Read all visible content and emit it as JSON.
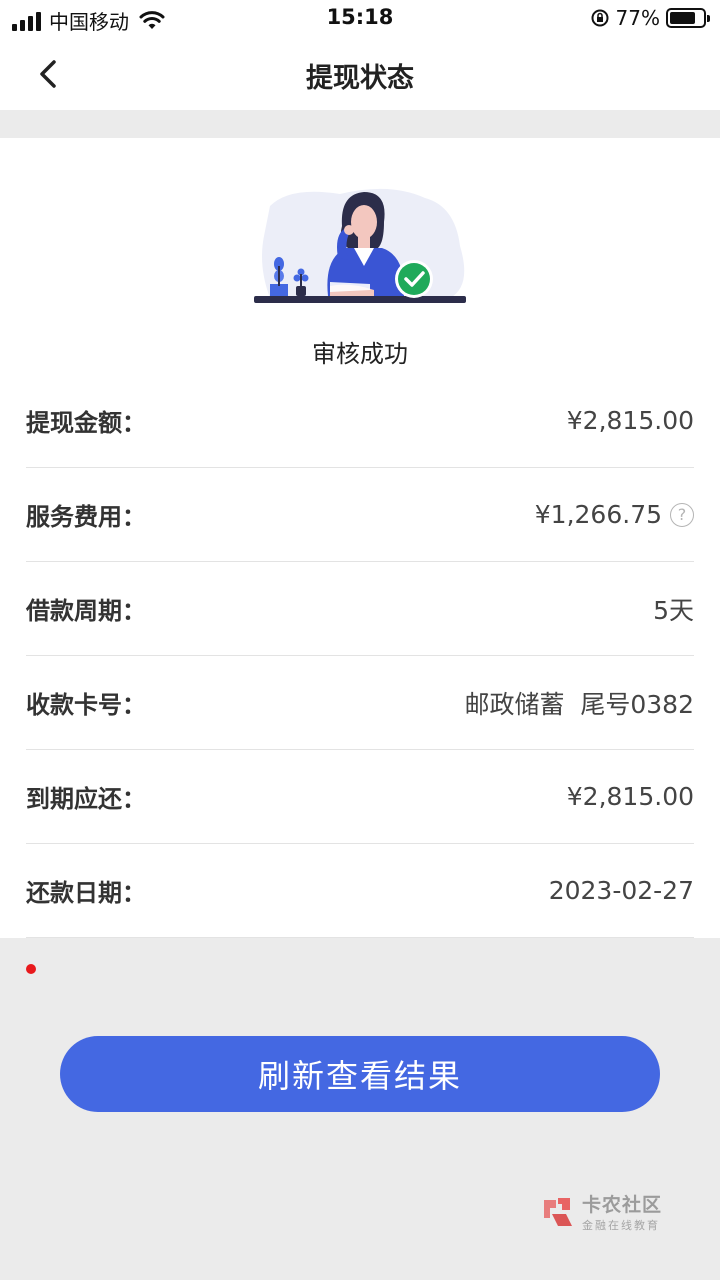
{
  "status_bar": {
    "carrier": "中国移动",
    "time": "15:18",
    "battery_percent": "77%",
    "battery_level": 0.77
  },
  "nav": {
    "back_icon": "chevron-left-icon",
    "title": "提现状态"
  },
  "status": {
    "text": "审核成功",
    "icon": "check-circle-icon",
    "accent_color": "#1faa5a"
  },
  "details": {
    "rows": [
      {
        "label": "提现金额：",
        "value": "¥2,815.00"
      },
      {
        "label": "服务费用：",
        "value": "¥1,266.75",
        "help_icon": "question-circle-icon"
      },
      {
        "label": "借款周期：",
        "value": "5天"
      },
      {
        "label": "收款卡号：",
        "value": "邮政储蓄  尾号0382"
      },
      {
        "label": "到期应还：",
        "value": "¥2,815.00"
      },
      {
        "label": "还款日期：",
        "value": "2023-02-27"
      }
    ]
  },
  "actions": {
    "refresh_label": "刷新查看结果",
    "button_color": "#4468e2"
  },
  "watermark": {
    "name": "卡农社区",
    "tagline": "金融在线教育"
  }
}
